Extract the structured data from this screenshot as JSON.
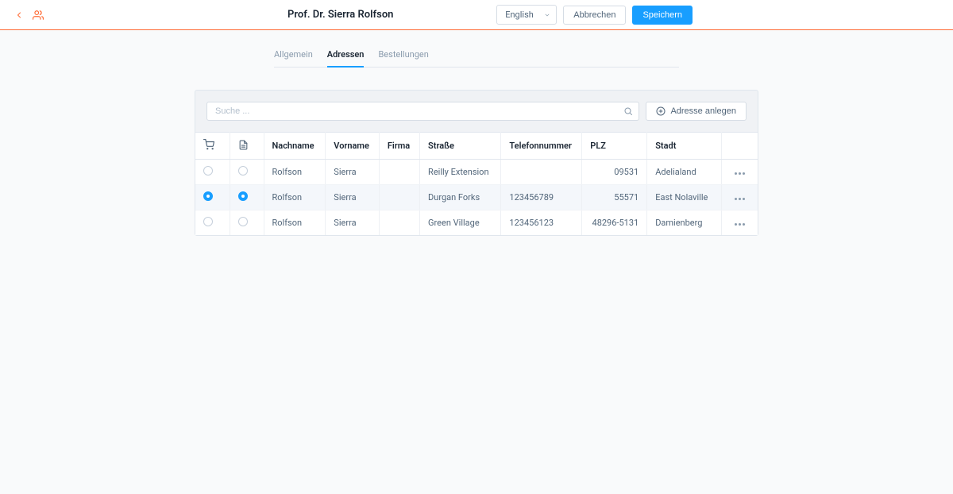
{
  "header": {
    "title": "Prof. Dr. Sierra Rolfson",
    "language_select": "English",
    "cancel_label": "Abbrechen",
    "save_label": "Speichern"
  },
  "tabs": {
    "general": "Allgemein",
    "addresses": "Adressen",
    "orders": "Bestellungen"
  },
  "toolbar": {
    "search_placeholder": "Suche ...",
    "add_address_label": "Adresse anlegen"
  },
  "table": {
    "columns": {
      "last_name": "Nachname",
      "first_name": "Vorname",
      "company": "Firma",
      "street": "Straße",
      "phone": "Telefonnummer",
      "zip": "PLZ",
      "city": "Stadt"
    },
    "rows": [
      {
        "default_shipping": false,
        "default_billing": false,
        "last_name": "Rolfson",
        "first_name": "Sierra",
        "company": "",
        "street": "Reilly Extension",
        "phone": "",
        "zip": "09531",
        "city": "Adelialand"
      },
      {
        "default_shipping": true,
        "default_billing": true,
        "last_name": "Rolfson",
        "first_name": "Sierra",
        "company": "",
        "street": "Durgan Forks",
        "phone": "123456789",
        "zip": "55571",
        "city": "East Nolaville"
      },
      {
        "default_shipping": false,
        "default_billing": false,
        "last_name": "Rolfson",
        "first_name": "Sierra",
        "company": "",
        "street": "Green Village",
        "phone": "123456123",
        "zip": "48296-5131",
        "city": "Damienberg"
      }
    ]
  }
}
